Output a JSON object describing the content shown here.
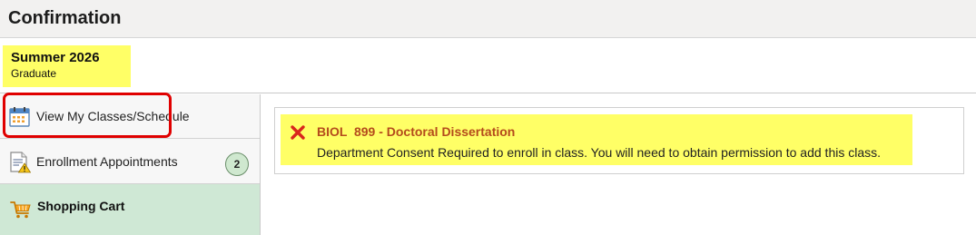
{
  "header": {
    "title": "Confirmation"
  },
  "term": {
    "name": "Summer 2026",
    "career": "Graduate"
  },
  "sidebar": {
    "items": [
      {
        "label": "View My Classes/Schedule",
        "icon": "calendar-icon"
      },
      {
        "label": "Enrollment Appointments",
        "icon": "document-warning-icon",
        "badge": "2"
      },
      {
        "label": "Shopping Cart",
        "icon": "shopping-cart-icon",
        "selected": true
      }
    ]
  },
  "message": {
    "title": "BIOL  899 - Doctoral Dissertation",
    "text": "Department Consent Required to enroll in class. You will need to obtain permission to add this class.",
    "icon": "error-x-icon"
  },
  "colors": {
    "highlight": "#ffff66",
    "selected_nav": "#cfe8d5",
    "error_title": "#b44b1c",
    "error_icon": "#d9261c",
    "annotation_ring": "#e00000"
  }
}
